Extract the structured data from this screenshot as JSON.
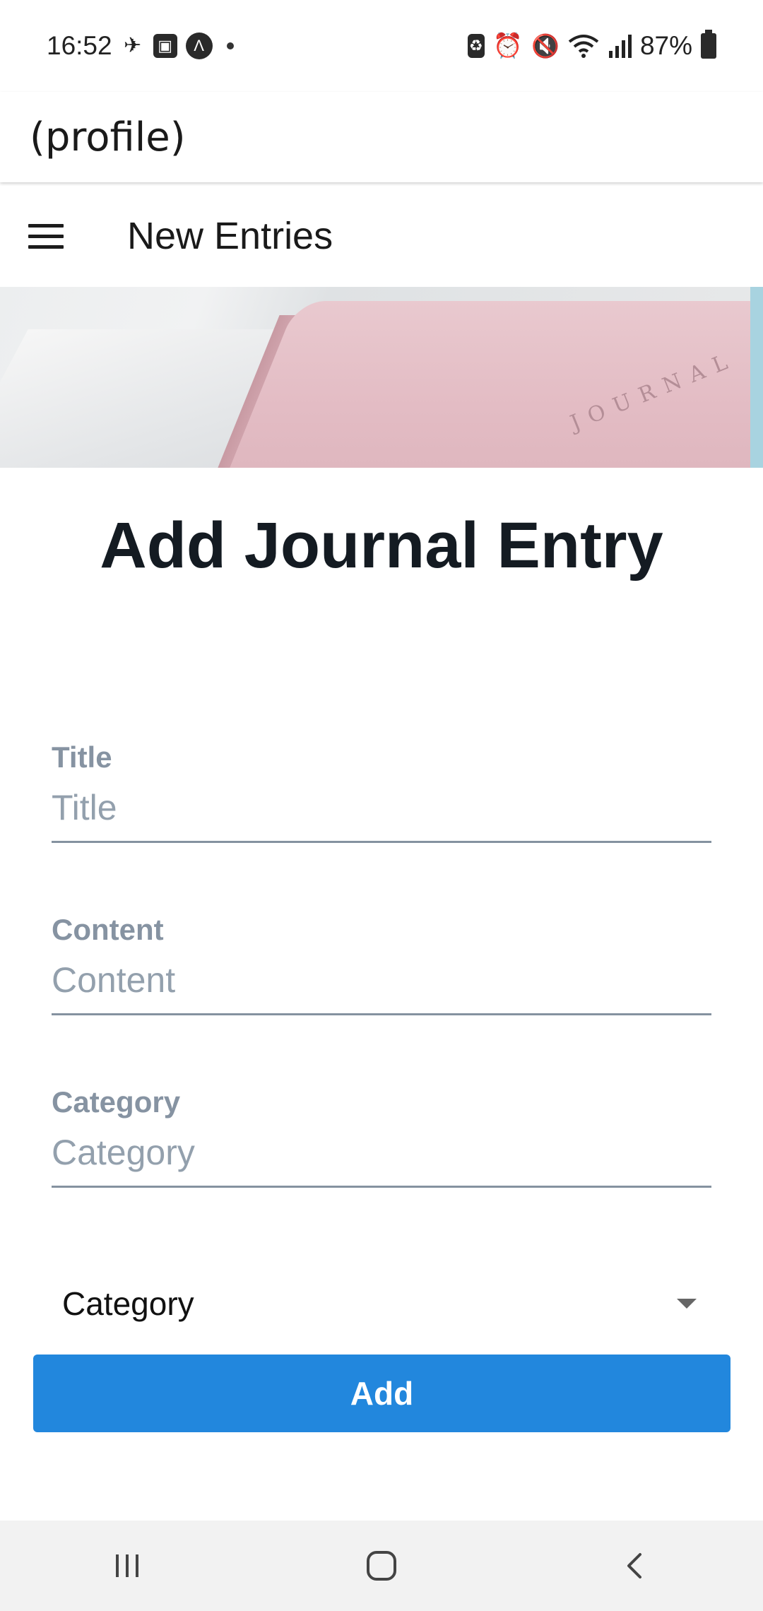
{
  "status_bar": {
    "time": "16:52",
    "battery": "87%"
  },
  "app_header": {
    "title": "(profile)"
  },
  "toolbar": {
    "title": "New Entries"
  },
  "hero": {
    "embossed_text": "JOURNAL"
  },
  "form": {
    "heading": "Add Journal Entry",
    "fields": [
      {
        "label": "Title",
        "placeholder": "Title",
        "value": ""
      },
      {
        "label": "Content",
        "placeholder": "Content",
        "value": ""
      },
      {
        "label": "Category",
        "placeholder": "Category",
        "value": ""
      }
    ],
    "select": {
      "selected": "Category"
    },
    "submit_label": "Add"
  },
  "colors": {
    "accent": "#2287dd",
    "label": "#8693a2",
    "heading": "#141b22"
  },
  "icons": {
    "menu": "hamburger-menu-icon",
    "dropdown": "chevron-down-icon",
    "nav_recents": "recents-icon",
    "nav_home": "home-icon",
    "nav_back": "back-icon"
  }
}
